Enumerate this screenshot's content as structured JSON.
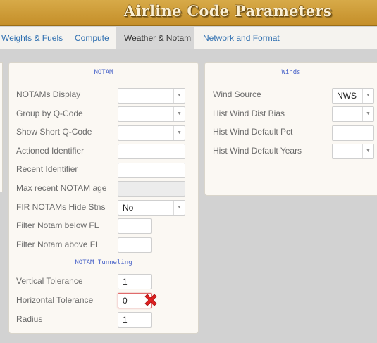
{
  "header": {
    "title": "Airline Code Parameters"
  },
  "tabs": [
    {
      "label": "Weights & Fuels"
    },
    {
      "label": "Compute"
    },
    {
      "label": "Weather & Notam"
    },
    {
      "label": "Network and Format"
    }
  ],
  "active_tab": "Weather & Notam",
  "notam": {
    "title": "NOTAM",
    "notams_display": {
      "label": "NOTAMs Display",
      "value": ""
    },
    "group_by_qcode": {
      "label": "Group by Q-Code",
      "value": ""
    },
    "show_short_qcode": {
      "label": "Show Short Q-Code",
      "value": ""
    },
    "actioned_identifier": {
      "label": "Actioned Identifier",
      "value": ""
    },
    "recent_identifier": {
      "label": "Recent Identifier",
      "value": ""
    },
    "max_recent_age": {
      "label": "Max recent NOTAM age",
      "value": ""
    },
    "fir_hide_stns": {
      "label": "FIR NOTAMs Hide Stns",
      "value": "No"
    },
    "filter_below": {
      "label": "Filter Notam below FL",
      "value": ""
    },
    "filter_above": {
      "label": "Filter Notam above FL",
      "value": ""
    },
    "tunneling": {
      "title": "NOTAM Tunneling",
      "vertical": {
        "label": "Vertical Tolerance",
        "value": "1"
      },
      "horizontal": {
        "label": "Horizontal Tolerance",
        "value": "0"
      },
      "radius": {
        "label": "Radius",
        "value": "1"
      }
    }
  },
  "winds": {
    "title": "Winds",
    "source": {
      "label": "Wind Source",
      "value": "NWS"
    },
    "dist_bias": {
      "label": "Hist Wind Dist Bias",
      "value": ""
    },
    "default_pct": {
      "label": "Hist Wind Default Pct",
      "value": ""
    },
    "default_years": {
      "label": "Hist Wind Default Years",
      "value": ""
    }
  },
  "colors": {
    "header_bg": "#c9952f",
    "tab_link": "#2f6fb0",
    "section_title": "#4a64c9",
    "error_mark": "#e02020"
  },
  "icons": {
    "error": "x-mark-icon",
    "dropdown": "chevron-down-icon"
  }
}
